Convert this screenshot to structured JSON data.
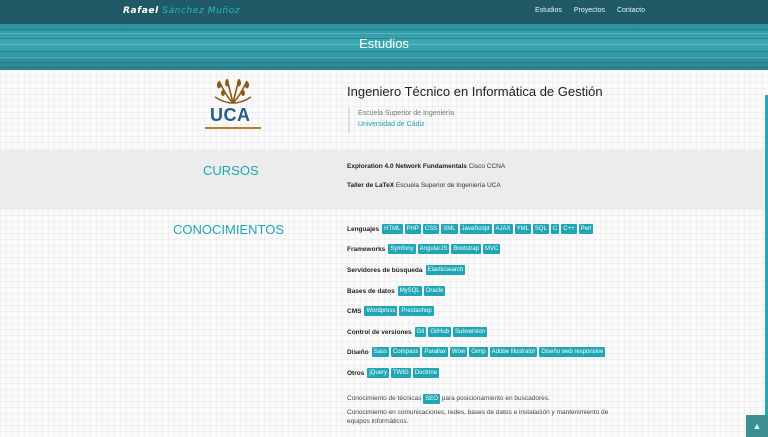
{
  "header": {
    "brand_first": "Rafael",
    "brand_last": "Sánchez Muñoz",
    "nav": [
      "Estudios",
      "Proyectos",
      "Contacto"
    ]
  },
  "hero": {
    "title": "Estudios"
  },
  "education": {
    "logo_text": "UCA",
    "degree": "Ingeniero Técnico en Informática de Gestión",
    "school": "Escuela Superior de Ingeniería",
    "university": "Universidad de Cádiz"
  },
  "courses": {
    "title": "CURSOS",
    "items": [
      {
        "name": "Exploration 4.0 Network Fundamentals",
        "provider": "Cisco CCNA"
      },
      {
        "name": "Taller de LaTeX",
        "provider": "Escuela Superior de Ingeniería UCA"
      }
    ]
  },
  "knowledge": {
    "title": "CONOCIMIENTOS",
    "rows": [
      {
        "label": "Lenguajes",
        "tags": [
          "HTML",
          "PHP",
          "CSS",
          "XML",
          "JavaScript",
          "AJAX",
          "YML",
          "SQL",
          "C",
          "C++",
          "Perl"
        ]
      },
      {
        "label": "Frameworks",
        "tags": [
          "Symfony",
          "AngularJS",
          "Bootstrap",
          "MVC"
        ]
      },
      {
        "label": "Servidores de búsqueda",
        "tags": [
          "Elasticsearch"
        ]
      },
      {
        "label": "Bases de datos",
        "tags": [
          "MySQL",
          "Oracle"
        ]
      },
      {
        "label": "CMS",
        "tags": [
          "Wordpress",
          "Prestashop"
        ]
      },
      {
        "label": "Control de versiones",
        "tags": [
          "Git",
          "GitHub",
          "Subversion"
        ]
      },
      {
        "label": "Diseño",
        "tags": [
          "Sass",
          "Compass",
          "Parallax",
          "Wow",
          "Gimp",
          "Adobe Illustrator",
          "Diseño web responsive"
        ]
      },
      {
        "label": "Otros",
        "tags": [
          "jQuery",
          "TWIG",
          "Doctrine"
        ]
      }
    ],
    "note1_before": "Conocimiento de técnicas",
    "note1_tag": "SEO",
    "note1_after": "para posicionamiento en buscadores.",
    "note2": "Conocimiento en comunicaciones, redes, bases de datos e instalación y mantenimiento de equipos informáticos."
  },
  "colors": {
    "accent": "#1fa6b5",
    "nav_bg": "#1f5a66",
    "logo_orange": "#c47a1f",
    "logo_blue": "#245e86"
  },
  "icons": {
    "scroll_top": "chevron-up-icon"
  }
}
